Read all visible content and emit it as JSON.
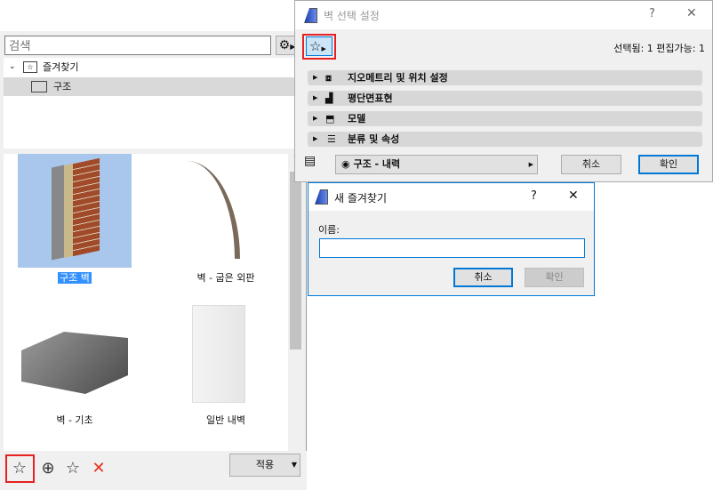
{
  "left_panel": {
    "search_placeholder": "검색",
    "tree": [
      {
        "label": "즐겨찾기"
      },
      {
        "label": "구조"
      }
    ],
    "items": [
      {
        "label": "구조 벽"
      },
      {
        "label": "벽 - 굽은 외판"
      },
      {
        "label": "벽 - 기초"
      },
      {
        "label": "일반 내벽"
      }
    ],
    "apply_label": "적용"
  },
  "main_dialog": {
    "title": "벽 선택 설정",
    "help": "?",
    "close": "✕",
    "status": "선택됨: 1 편집가능: 1",
    "sections": [
      {
        "label": "지오메트리 및 위치 설정"
      },
      {
        "label": "평단면표현"
      },
      {
        "label": "모델"
      },
      {
        "label": "분류 및 속성"
      }
    ],
    "layer": "구조 - 내력",
    "cancel": "취소",
    "ok": "확인"
  },
  "new_favorite_dialog": {
    "title": "새 즐겨찾기",
    "help": "?",
    "close": "✕",
    "name_label": "이름:",
    "name_value": "",
    "cancel": "취소",
    "ok": "확인"
  }
}
